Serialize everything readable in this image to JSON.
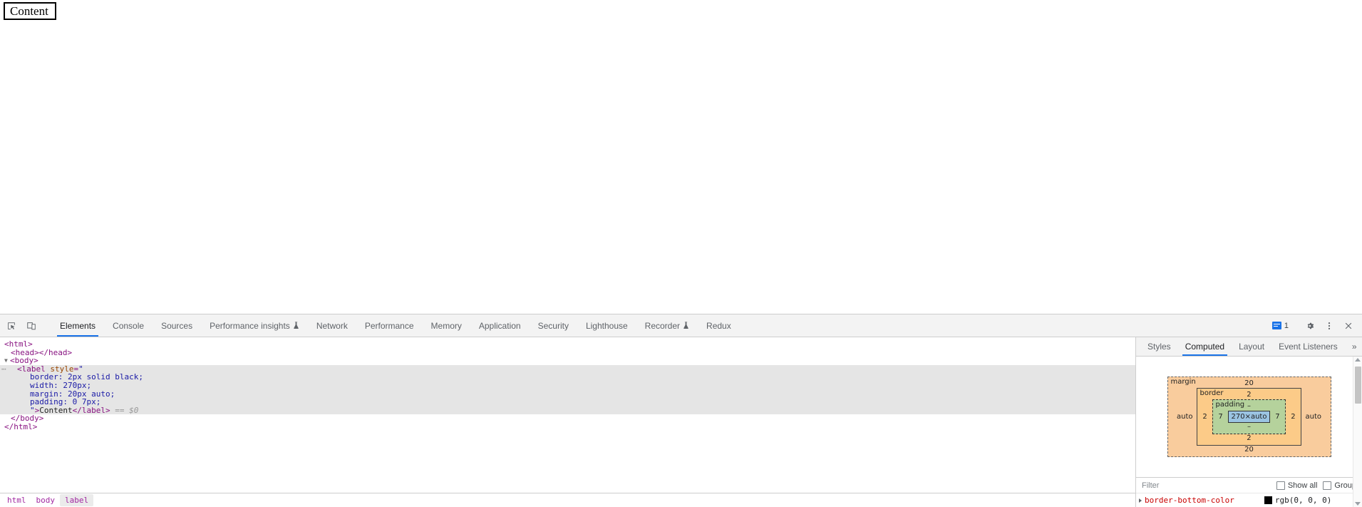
{
  "page": {
    "label_text": "Content"
  },
  "devtools": {
    "toolbar": {
      "inspect_icon": "inspect-cursor-icon",
      "device_icon": "device-toolbar-icon",
      "message_count": "1",
      "settings_icon": "gear-icon",
      "more_icon": "kebab-menu-icon",
      "close_icon": "close-icon",
      "tabs": [
        {
          "label": "Elements",
          "active": true,
          "badge": ""
        },
        {
          "label": "Console",
          "active": false,
          "badge": ""
        },
        {
          "label": "Sources",
          "active": false,
          "badge": ""
        },
        {
          "label": "Performance insights",
          "active": false,
          "badge": "flask"
        },
        {
          "label": "Network",
          "active": false,
          "badge": ""
        },
        {
          "label": "Performance",
          "active": false,
          "badge": ""
        },
        {
          "label": "Memory",
          "active": false,
          "badge": ""
        },
        {
          "label": "Application",
          "active": false,
          "badge": ""
        },
        {
          "label": "Security",
          "active": false,
          "badge": ""
        },
        {
          "label": "Lighthouse",
          "active": false,
          "badge": ""
        },
        {
          "label": "Recorder",
          "active": false,
          "badge": "flask"
        },
        {
          "label": "Redux",
          "active": false,
          "badge": ""
        }
      ]
    },
    "dom_tree": {
      "lines": [
        {
          "indent": 0,
          "html": "<span class=\"punc\">&lt;</span><span class=\"tw\">html</span><span class=\"punc\">&gt;</span>",
          "selected": false,
          "dots": false
        },
        {
          "indent": 1,
          "html": "<span class=\"punc\">&lt;</span><span class=\"tw\">head</span><span class=\"punc\">&gt;&lt;/</span><span class=\"tw\">head</span><span class=\"punc\">&gt;</span>",
          "selected": false,
          "dots": false
        },
        {
          "indent": 0,
          "html": "<span class=\"arrow-t\">▼</span><span class=\"punc\">&lt;</span><span class=\"tw\">body</span><span class=\"punc\">&gt;</span>",
          "selected": false,
          "dots": false
        },
        {
          "indent": 2,
          "html": "<span class=\"punc\">&lt;</span><span class=\"tw\">label</span> <span class=\"attr\">style</span><span class=\"punc\">=</span><span class=\"val\">\"</span>",
          "selected": true,
          "dots": true
        },
        {
          "indent": 4,
          "html": "<span class=\"val\">border: 2px solid black;</span>",
          "selected": true,
          "dots": false
        },
        {
          "indent": 4,
          "html": "<span class=\"val\">width: 270px;</span>",
          "selected": true,
          "dots": false
        },
        {
          "indent": 4,
          "html": "<span class=\"val\">margin: 20px auto;</span>",
          "selected": true,
          "dots": false
        },
        {
          "indent": 4,
          "html": "<span class=\"val\">padding: 0 7px;</span>",
          "selected": true,
          "dots": false
        },
        {
          "indent": 4,
          "html": "<span class=\"val\">\"</span><span class=\"punc\">&gt;</span><span class=\"txt\">Content</span><span class=\"punc\">&lt;/</span><span class=\"tw\">label</span><span class=\"punc\">&gt;</span> <span class=\"dollar\">== $0</span>",
          "selected": true,
          "dots": false
        },
        {
          "indent": 1,
          "html": "<span class=\"punc\">&lt;/</span><span class=\"tw\">body</span><span class=\"punc\">&gt;</span>",
          "selected": false,
          "dots": false
        },
        {
          "indent": 0,
          "html": "<span class=\"punc\">&lt;/</span><span class=\"tw\">html</span><span class=\"punc\">&gt;</span>",
          "selected": false,
          "dots": false
        }
      ]
    },
    "breadcrumb": [
      {
        "label": "html",
        "active": false
      },
      {
        "label": "body",
        "active": false
      },
      {
        "label": "label",
        "active": true
      }
    ],
    "sidebar": {
      "tabs": [
        {
          "label": "Styles",
          "active": false
        },
        {
          "label": "Computed",
          "active": true
        },
        {
          "label": "Layout",
          "active": false
        },
        {
          "label": "Event Listeners",
          "active": false
        }
      ],
      "overflow_label": "»",
      "box_model": {
        "margin_label": "margin",
        "margin_top": "20",
        "margin_right": "auto",
        "margin_bottom": "20",
        "margin_left": "auto",
        "border_label": "border",
        "border_top": "2",
        "border_right": "2",
        "border_bottom": "2",
        "border_left": "2",
        "padding_label": "padding",
        "padding_top": "–",
        "padding_right": "7",
        "padding_bottom": "–",
        "padding_left": "7",
        "content_size": "270×auto",
        "colors": {
          "margin": "#f9cc9d",
          "border": "#fccb88",
          "padding": "#b5d29c",
          "content": "#9bc4e2"
        }
      },
      "filter": {
        "value": "",
        "placeholder": "Filter",
        "show_all_label": "Show all",
        "show_all_checked": false,
        "group_label": "Group",
        "group_checked": false
      },
      "properties": [
        {
          "name": "border-bottom-color",
          "value": "rgb(0, 0, 0)",
          "swatch": "#000000"
        }
      ]
    }
  }
}
